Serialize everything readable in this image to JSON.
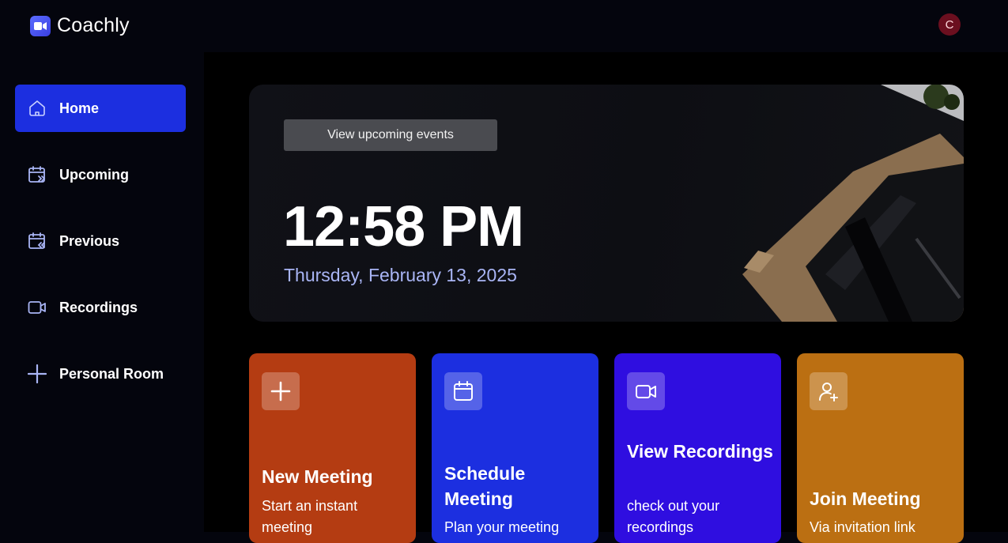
{
  "app": {
    "name": "Coachly",
    "avatar_letter": "C"
  },
  "sidebar": {
    "items": [
      {
        "label": "Home",
        "icon": "home-icon",
        "active": true
      },
      {
        "label": "Upcoming",
        "icon": "calendar-forward-icon",
        "active": false
      },
      {
        "label": "Previous",
        "icon": "calendar-back-icon",
        "active": false
      },
      {
        "label": "Recordings",
        "icon": "video-icon",
        "active": false
      },
      {
        "label": "Personal Room",
        "icon": "plus-icon",
        "active": false
      }
    ]
  },
  "hero": {
    "button_label": "View upcoming events",
    "time": "12:58 PM",
    "date": "Thursday, February 13, 2025"
  },
  "cards": [
    {
      "title": "New Meeting",
      "subtitle": "Start an instant meeting",
      "icon": "plus-icon",
      "color": "#b43c12"
    },
    {
      "title": "Schedule Meeting",
      "subtitle": "Plan your meeting",
      "icon": "calendar-icon",
      "color": "#1c2fe0"
    },
    {
      "title": "View Recordings",
      "subtitle": "check out your recordings",
      "icon": "video-icon",
      "color": "#2f0ee0"
    },
    {
      "title": "Join Meeting",
      "subtitle": "Via invitation link",
      "icon": "user-plus-icon",
      "color": "#bb6f12"
    }
  ],
  "colors": {
    "accent": "#1c2fe0",
    "date_text": "#a9b5f5",
    "background": "#000000"
  }
}
